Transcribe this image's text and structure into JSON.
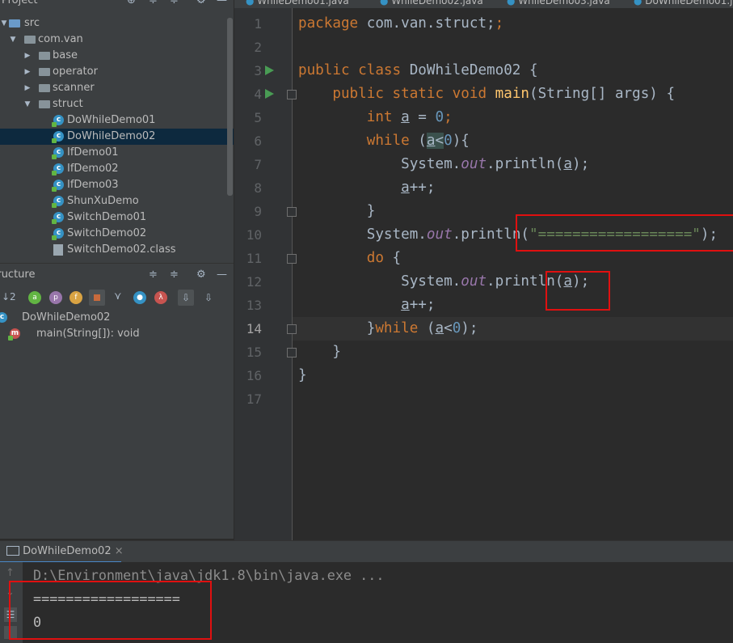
{
  "project_panel": {
    "title": "Project",
    "tree": [
      {
        "label": "src",
        "type": "src-folder",
        "expanded": true
      },
      {
        "label": "com.van",
        "type": "package",
        "expanded": true
      },
      {
        "label": "base",
        "type": "package",
        "expanded": false
      },
      {
        "label": "operator",
        "type": "package",
        "expanded": false
      },
      {
        "label": "scanner",
        "type": "package",
        "expanded": false
      },
      {
        "label": "struct",
        "type": "package",
        "expanded": true
      },
      {
        "label": "DoWhileDemo01",
        "type": "class"
      },
      {
        "label": "DoWhileDemo02",
        "type": "class",
        "selected": true
      },
      {
        "label": "IfDemo01",
        "type": "class"
      },
      {
        "label": "IfDemo02",
        "type": "class"
      },
      {
        "label": "IfDemo03",
        "type": "class"
      },
      {
        "label": "ShunXuDemo",
        "type": "class"
      },
      {
        "label": "SwitchDemo01",
        "type": "class"
      },
      {
        "label": "SwitchDemo02",
        "type": "class"
      },
      {
        "label": "SwitchDemo02.class",
        "type": "class-file"
      }
    ]
  },
  "structure_panel": {
    "title": "Structure",
    "toolbar_icons": [
      "sort-visibility-icon",
      "anonymous-icon",
      "property-icon",
      "field-icon",
      "non-public-icon",
      "inherited-icon",
      "show-members-icon",
      "lambda-icon",
      "autoscroll-to-source-icon",
      "autoscroll-from-source-icon"
    ],
    "items": [
      {
        "label": "DoWhileDemo02",
        "kind": "class"
      },
      {
        "label": "main(String[]): void",
        "kind": "method"
      }
    ]
  },
  "editor": {
    "tabs": [
      "WhileDemo01.java",
      "WhileDemo02.java",
      "WhileDemo03.java",
      "DoWhileDemo01.j"
    ],
    "current_line": 14,
    "line_numbers": [
      "1",
      "2",
      "3",
      "4",
      "5",
      "6",
      "7",
      "8",
      "9",
      "10",
      "11",
      "12",
      "13",
      "14",
      "15",
      "16",
      "17"
    ],
    "lines": {
      "l1": {
        "kw": "package",
        "rest": " com.van.struct;"
      },
      "l3": {
        "kw1": "public class",
        "name": "DoWhileDemo02",
        "rest": " {"
      },
      "l4": {
        "kw1": "public static void",
        "fn": "main",
        "rest": "(String[] args) {"
      },
      "l5": {
        "kw": "int",
        "var": "a",
        "eq": " = ",
        "num": "0",
        "end": ";"
      },
      "l6": {
        "kw": "while",
        "open": " (",
        "var": "a",
        "op": "<",
        "num": "0",
        "close": "){"
      },
      "l7": {
        "obj": "System.",
        "fld": "out",
        "call": ".println(",
        "var": "a",
        "close": ");"
      },
      "l8": {
        "var": "a",
        "rest": "++;"
      },
      "l9": {
        "rest": "}"
      },
      "l10": {
        "obj": "System.",
        "fld": "out",
        "call": ".println(",
        "str": "\"==================\"",
        "close": ");"
      },
      "l11": {
        "kw": "do",
        "rest": " {"
      },
      "l12": {
        "obj": "System.",
        "fld": "out",
        "call": ".println(",
        "var": "a",
        "close": ");"
      },
      "l13": {
        "var": "a",
        "rest": "++;"
      },
      "l14": {
        "open": "}",
        "kw": "while",
        "paren": " (",
        "var": "a",
        "op": "<",
        "num": "0",
        "close": ");"
      },
      "l15": {
        "rest": "}"
      },
      "l16": {
        "rest": "}"
      }
    }
  },
  "run_panel": {
    "tab_label": "DoWhileDemo02",
    "close_glyph": "×",
    "console": [
      "D:\\Environment\\java\\jdk1.8\\bin\\java.exe ...",
      "==================",
      "0"
    ]
  },
  "colors": {
    "keyword": "#cc7832",
    "function": "#ffc66d",
    "number": "#6897bb",
    "string": "#6a8759",
    "field": "#9876aa",
    "annotation_box": "#e01010",
    "selection": "#0d293e"
  }
}
